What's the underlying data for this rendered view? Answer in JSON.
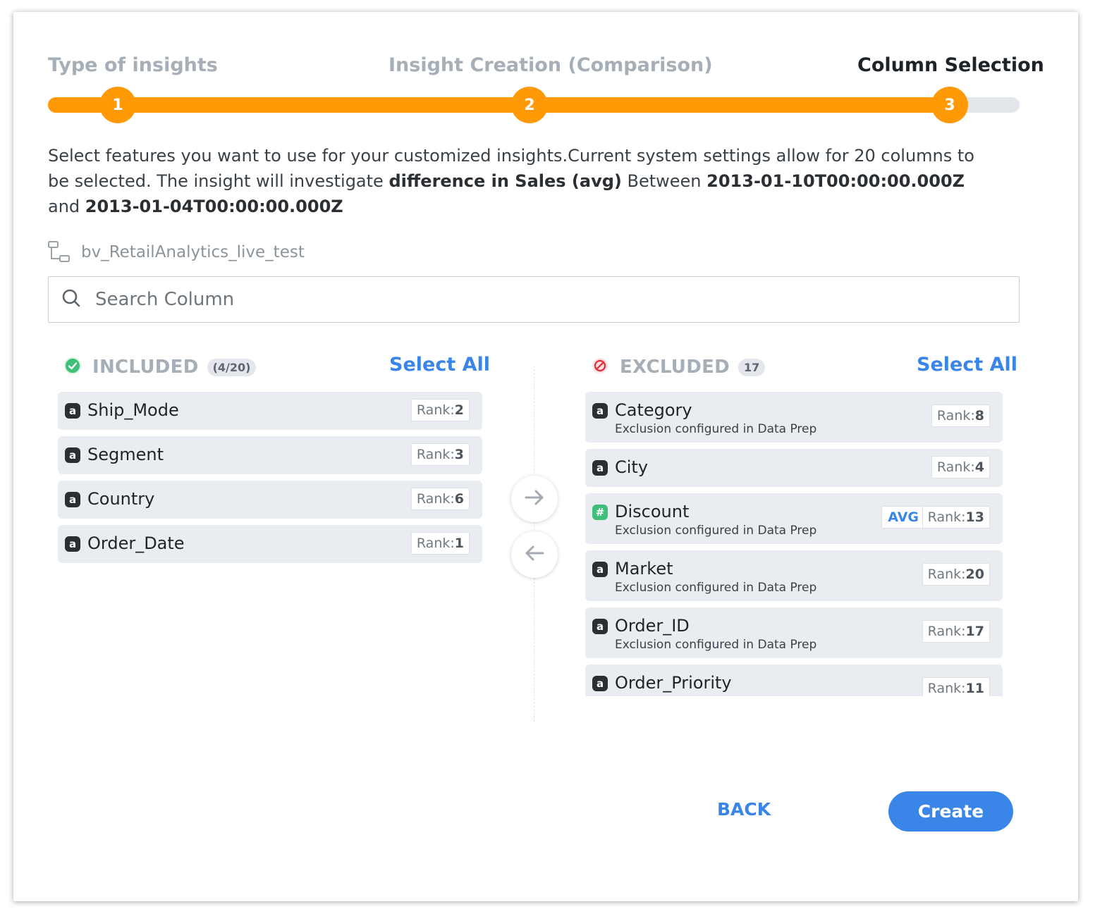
{
  "stepper": {
    "steps": [
      {
        "number": "1",
        "title": "Type of insights"
      },
      {
        "number": "2",
        "title": "Insight Creation (Comparison)"
      },
      {
        "number": "3",
        "title": "Column Selection"
      }
    ],
    "accent_color": "#ff9a06"
  },
  "description": {
    "prefix": "Select features you want to use for your customized insights.Current system settings allow for 20 columns to be selected. The insight will investigate ",
    "metric": "difference in Sales (avg)",
    "between_label": " Between ",
    "date_from": "2013-01-10T00:00:00.000Z",
    "and_label": " and ",
    "date_to": "2013-01-04T00:00:00.000Z"
  },
  "dataset": {
    "name": "bv_RetailAnalytics_live_test",
    "icon": "dataset-icon"
  },
  "search": {
    "placeholder": "Search Column",
    "value": ""
  },
  "included": {
    "title": "INCLUDED",
    "count": "(4/20)",
    "select_all": "Select All",
    "status_color": "#3ec07a",
    "items": [
      {
        "type": "a",
        "name": "Ship_Mode",
        "rank_label": "Rank:",
        "rank": "2"
      },
      {
        "type": "a",
        "name": "Segment",
        "rank_label": "Rank:",
        "rank": "3"
      },
      {
        "type": "a",
        "name": "Country",
        "rank_label": "Rank:",
        "rank": "6"
      },
      {
        "type": "a",
        "name": "Order_Date",
        "rank_label": "Rank:",
        "rank": "1"
      }
    ]
  },
  "excluded": {
    "title": "EXCLUDED",
    "count": "17",
    "select_all": "Select All",
    "status_color": "#e2343f",
    "items": [
      {
        "type": "a",
        "name": "Category",
        "sub": "Exclusion configured in Data Prep",
        "rank_label": "Rank:",
        "rank": "8"
      },
      {
        "type": "a",
        "name": "City",
        "rank_label": "Rank:",
        "rank": "4"
      },
      {
        "type": "#",
        "name": "Discount",
        "sub": "Exclusion configured in Data Prep",
        "tag": "AVG",
        "rank_label": "Rank:",
        "rank": "13"
      },
      {
        "type": "a",
        "name": "Market",
        "sub": "Exclusion configured in Data Prep",
        "rank_label": "Rank:",
        "rank": "20"
      },
      {
        "type": "a",
        "name": "Order_ID",
        "sub": "Exclusion configured in Data Prep",
        "rank_label": "Rank:",
        "rank": "17"
      },
      {
        "type": "a",
        "name": "Order_Priority",
        "rank_label": "Rank:",
        "rank": "11"
      }
    ]
  },
  "actions": {
    "back": "BACK",
    "create": "Create",
    "primary_color": "#3a86e8"
  }
}
